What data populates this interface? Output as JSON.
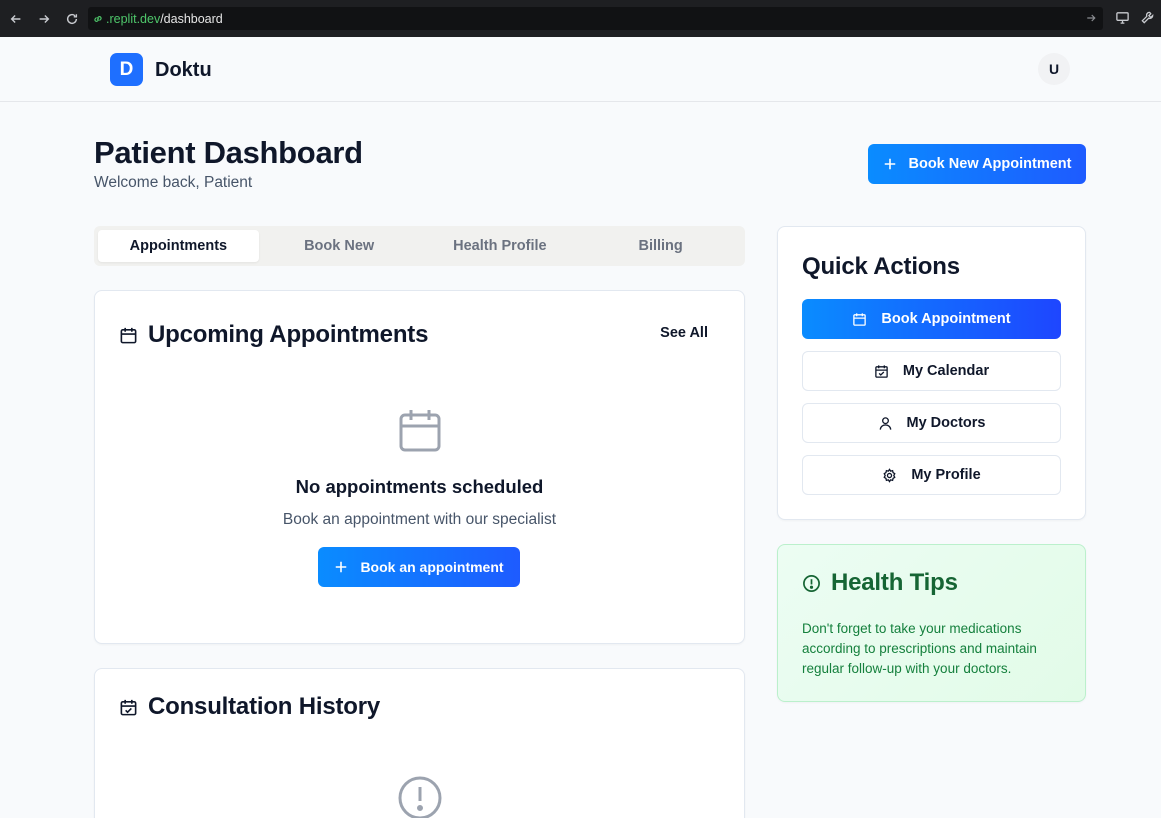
{
  "browser": {
    "url_domain": ".replit.dev",
    "url_path": "/dashboard"
  },
  "header": {
    "logo_letter": "D",
    "brand": "Doktu",
    "avatar_initial": "U"
  },
  "page": {
    "title": "Patient Dashboard",
    "subtitle": "Welcome back, Patient",
    "book_new_label": "Book New Appointment"
  },
  "tabs": [
    {
      "label": "Appointments",
      "active": true
    },
    {
      "label": "Book New",
      "active": false
    },
    {
      "label": "Health Profile",
      "active": false
    },
    {
      "label": "Billing",
      "active": false
    }
  ],
  "upcoming": {
    "title": "Upcoming Appointments",
    "see_all": "See All",
    "empty_title": "No appointments scheduled",
    "empty_sub": "Book an appointment with our specialist",
    "book_label": "Book an appointment"
  },
  "history": {
    "title": "Consultation History"
  },
  "quick_actions": {
    "title": "Quick Actions",
    "items": [
      {
        "label": "Book Appointment",
        "icon": "calendar-icon"
      },
      {
        "label": "My Calendar",
        "icon": "calendar-check-icon"
      },
      {
        "label": "My Doctors",
        "icon": "user-icon"
      },
      {
        "label": "My Profile",
        "icon": "gear-icon"
      }
    ]
  },
  "health_tips": {
    "title": "Health Tips",
    "text": "Don't forget to take your medications according to prescriptions and maintain regular follow-up with your doctors."
  },
  "colors": {
    "primary": "#1e6fff",
    "tips_green": "#166534"
  }
}
